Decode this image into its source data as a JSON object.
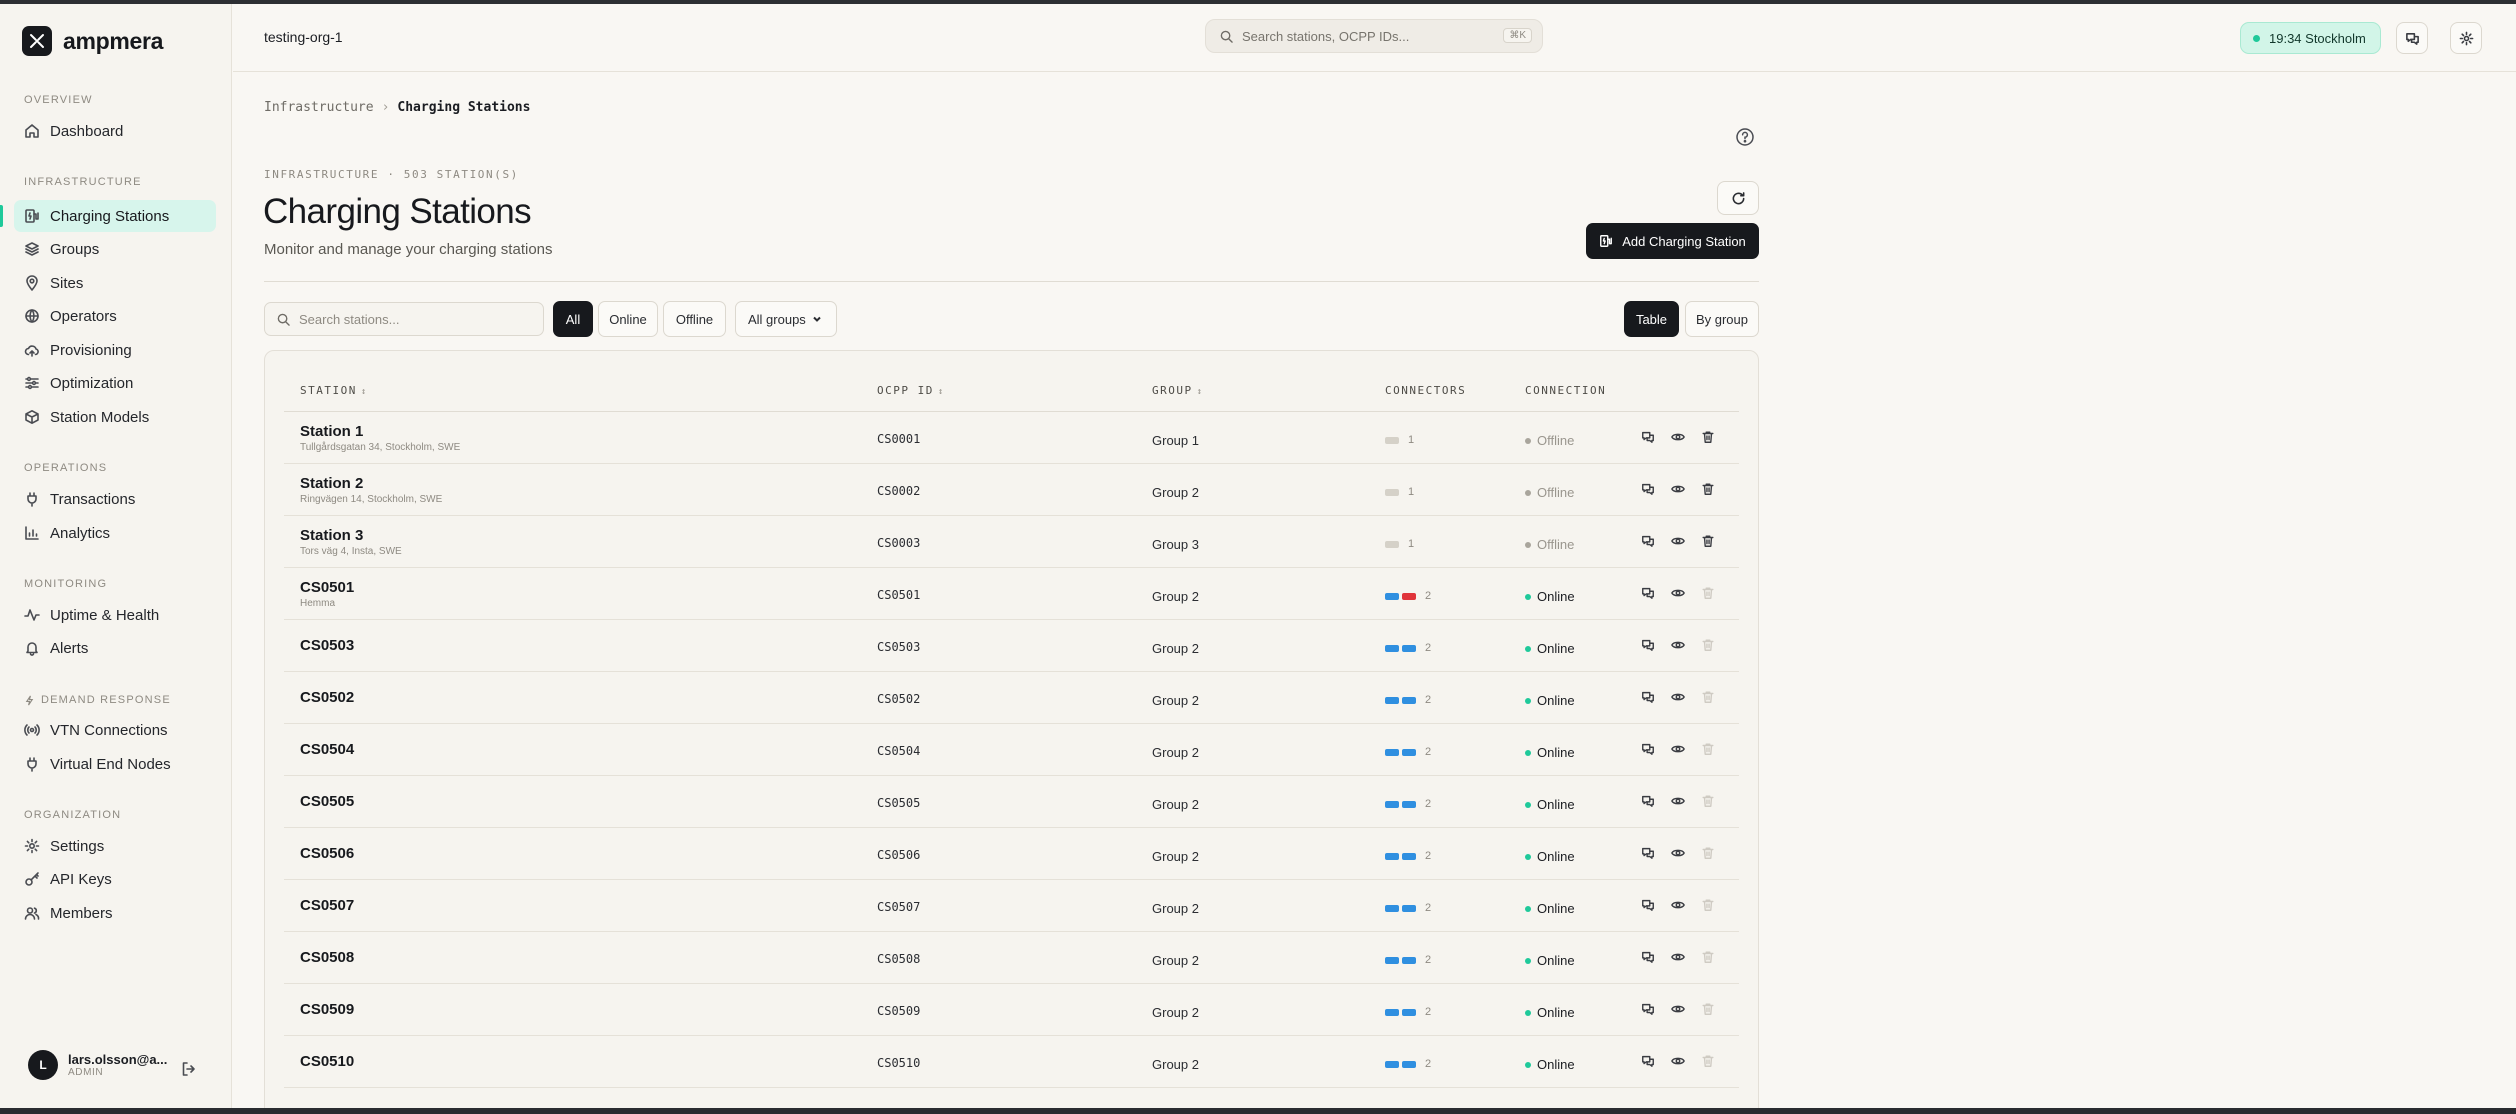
{
  "brand": {
    "name": "ampmera"
  },
  "header": {
    "org": "testing-org-1",
    "search_placeholder": "Search stations, OCPP IDs...",
    "search_shortcut": "⌘K",
    "clock": "19:34 Stockholm"
  },
  "sidebar": {
    "sections": {
      "overview": "OVERVIEW",
      "infrastructure": "INFRASTRUCTURE",
      "operations": "OPERATIONS",
      "monitoring": "MONITORING",
      "demand_response": "DEMAND RESPONSE",
      "organization": "ORGANIZATION"
    },
    "items": {
      "dashboard": "Dashboard",
      "charging_stations": "Charging Stations",
      "groups": "Groups",
      "sites": "Sites",
      "operators": "Operators",
      "provisioning": "Provisioning",
      "optimization": "Optimization",
      "station_models": "Station Models",
      "transactions": "Transactions",
      "analytics": "Analytics",
      "uptime": "Uptime & Health",
      "alerts": "Alerts",
      "vtn": "VTN Connections",
      "ven": "Virtual End Nodes",
      "settings": "Settings",
      "api_keys": "API Keys",
      "members": "Members"
    },
    "user": {
      "initial": "L",
      "email": "lars.olsson@a...",
      "role": "ADMIN"
    }
  },
  "breadcrumb": {
    "parent": "Infrastructure",
    "separator": "›",
    "current": "Charging Stations"
  },
  "page": {
    "eyebrow": "INFRASTRUCTURE · 503 STATION(S)",
    "title": "Charging Stations",
    "subtitle": "Monitor and manage your charging stations",
    "add_button": "Add Charging Station"
  },
  "toolbar": {
    "search_placeholder": "Search stations...",
    "filters": [
      "All",
      "Online",
      "Offline"
    ],
    "active_filter": "All",
    "group_select": "All groups",
    "views": [
      "Table",
      "By group"
    ],
    "active_view": "Table"
  },
  "table": {
    "columns": [
      "STATION",
      "OCPP ID",
      "GROUP",
      "CONNECTORS",
      "CONNECTION"
    ],
    "rows": [
      {
        "name": "Station 1",
        "address": "Tullgårdsgatan 34, Stockholm, SWE",
        "ocpp": "CS0001",
        "group": "Group 1",
        "connectors": [
          "idle"
        ],
        "count": "1",
        "status": "Offline"
      },
      {
        "name": "Station 2",
        "address": "Ringvägen 14, Stockholm, SWE",
        "ocpp": "CS0002",
        "group": "Group 2",
        "connectors": [
          "idle"
        ],
        "count": "1",
        "status": "Offline"
      },
      {
        "name": "Station 3",
        "address": "Tors väg 4, Insta, SWE",
        "ocpp": "CS0003",
        "group": "Group 3",
        "connectors": [
          "idle"
        ],
        "count": "1",
        "status": "Offline"
      },
      {
        "name": "CS0501",
        "address": "Hemma",
        "ocpp": "CS0501",
        "group": "Group 2",
        "connectors": [
          "available",
          "faulted"
        ],
        "count": "2",
        "status": "Online"
      },
      {
        "name": "CS0503",
        "address": "",
        "ocpp": "CS0503",
        "group": "Group 2",
        "connectors": [
          "available",
          "available"
        ],
        "count": "2",
        "status": "Online"
      },
      {
        "name": "CS0502",
        "address": "",
        "ocpp": "CS0502",
        "group": "Group 2",
        "connectors": [
          "available",
          "available"
        ],
        "count": "2",
        "status": "Online"
      },
      {
        "name": "CS0504",
        "address": "",
        "ocpp": "CS0504",
        "group": "Group 2",
        "connectors": [
          "available",
          "available"
        ],
        "count": "2",
        "status": "Online"
      },
      {
        "name": "CS0505",
        "address": "",
        "ocpp": "CS0505",
        "group": "Group 2",
        "connectors": [
          "available",
          "available"
        ],
        "count": "2",
        "status": "Online"
      },
      {
        "name": "CS0506",
        "address": "",
        "ocpp": "CS0506",
        "group": "Group 2",
        "connectors": [
          "available",
          "available"
        ],
        "count": "2",
        "status": "Online"
      },
      {
        "name": "CS0507",
        "address": "",
        "ocpp": "CS0507",
        "group": "Group 2",
        "connectors": [
          "available",
          "available"
        ],
        "count": "2",
        "status": "Online"
      },
      {
        "name": "CS0508",
        "address": "",
        "ocpp": "CS0508",
        "group": "Group 2",
        "connectors": [
          "available",
          "available"
        ],
        "count": "2",
        "status": "Online"
      },
      {
        "name": "CS0509",
        "address": "",
        "ocpp": "CS0509",
        "group": "Group 2",
        "connectors": [
          "available",
          "available"
        ],
        "count": "2",
        "status": "Online"
      },
      {
        "name": "CS0510",
        "address": "",
        "ocpp": "CS0510",
        "group": "Group 2",
        "connectors": [
          "available",
          "available"
        ],
        "count": "2",
        "status": "Online"
      }
    ]
  },
  "colors": {
    "accent": "#1fc99a",
    "connector_available": "#2f8fe0",
    "connector_faulted": "#e0343a",
    "connector_idle": "#d5d1c8",
    "status_online": "#1fc99a",
    "status_offline": "#a9a59c"
  }
}
